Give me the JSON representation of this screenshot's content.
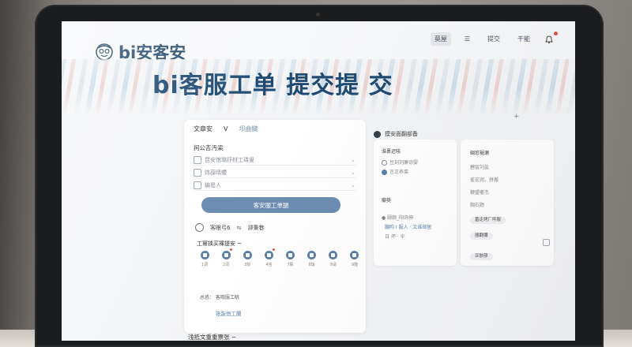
{
  "scene": {
    "device": "laptop",
    "colors": {
      "accent": "#6b8eb2",
      "brand": "#2a4d6e",
      "alert": "#e05545"
    }
  },
  "header": {
    "logo_text": "bi安客安",
    "nav": [
      {
        "label": "莫屋",
        "active": true
      },
      {
        "label": "☰",
        "icon": "menu-icon"
      },
      {
        "label": "提交"
      },
      {
        "label": "干能"
      },
      {
        "label": "",
        "icon": "bell-icon"
      }
    ]
  },
  "banner": {
    "title": "bi客服工单 提交提 交"
  },
  "form": {
    "tabs": [
      "文章安",
      "Ⅴ",
      "坝曲臟"
    ],
    "section_label": "抲公吉汚栥",
    "fields": [
      {
        "icon": "doc-icon",
        "text": "昆安馆璐抒材工璘叟"
      },
      {
        "icon": "alert-icon",
        "text": "炜薛晴蠳"
      },
      {
        "icon": "user-icon",
        "text": "编曷人"
      }
    ],
    "submit_label": "客安服工单腿",
    "status_text": "客眼弓6",
    "status_link": "泖秉巷",
    "subtitle": "工幂挟买裸提安 ~",
    "categories": [
      {
        "label": "1调",
        "alert": false
      },
      {
        "label": "2词",
        "alert": true
      },
      {
        "label": "3前",
        "alert": false
      },
      {
        "label": "4咨",
        "alert": true
      },
      {
        "label": "7陈",
        "alert": false
      },
      {
        "label": "8饭",
        "alert": false
      },
      {
        "label": "9请",
        "alert": false
      },
      {
        "label": "9隆",
        "alert": false
      }
    ],
    "meta_text": "总惑： 客哦服工眺",
    "meta_link": "祇翫愡工腸",
    "bottom_title": "浅抵文重重票张 ~"
  },
  "side": {
    "search_label": "摸安面翻部备",
    "panel_a": {
      "title": "淮裹迟咳",
      "options": [
        {
          "label": "豆刻刘廉谅婴",
          "selected": false
        },
        {
          "label": "言正养菜",
          "selected": true
        }
      ],
      "section": "瓣奨",
      "user": "颐颇_阳询伸",
      "links": [
        "蹦昀 I 服人 · 文淮邮居",
        "日 坏 · 伞"
      ]
    },
    "panel_b": {
      "title": "碉慾裾濑",
      "items": [
        "碧层刘盐",
        "雀宏润，拼搬",
        "鞭盟奢杰",
        "胸石题"
      ],
      "pills": [
        "墓走烤厂呼服",
        "器翻彌",
        "亚骸颚"
      ]
    }
  }
}
